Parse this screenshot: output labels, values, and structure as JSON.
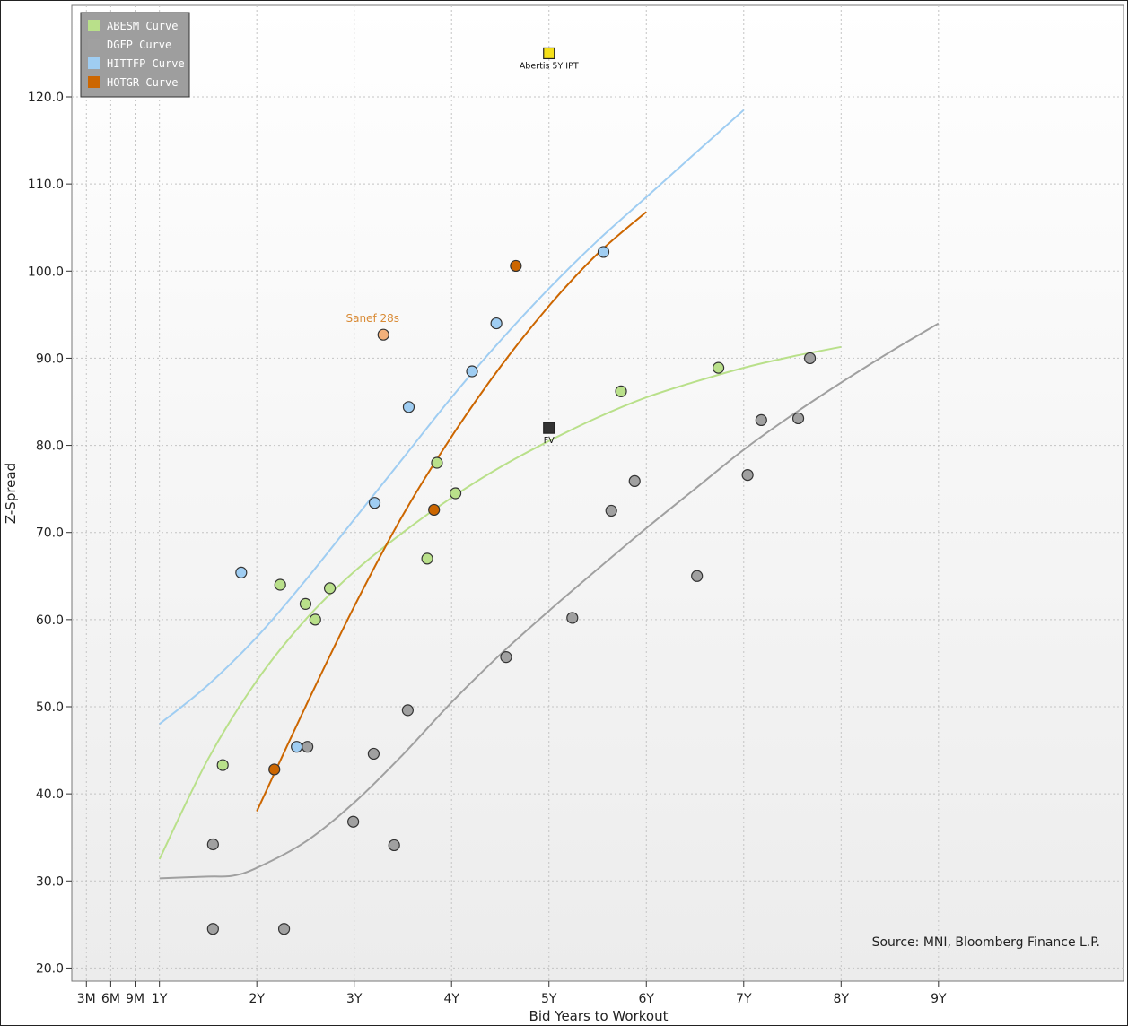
{
  "chart_data": {
    "type": "scatter",
    "title": "",
    "xlabel": "Bid Years to Workout",
    "ylabel": "Z-Spread",
    "xlim": [
      -0.9,
      9.9
    ],
    "ylim": [
      18.5,
      130.5
    ],
    "x_ticks": [
      {
        "value": -0.75,
        "label": "3M"
      },
      {
        "value": -0.5,
        "label": "6M"
      },
      {
        "value": -0.25,
        "label": "9M"
      },
      {
        "value": 0,
        "label": "1Y"
      },
      {
        "value": 1,
        "label": "2Y"
      },
      {
        "value": 2,
        "label": "3Y"
      },
      {
        "value": 3,
        "label": "4Y"
      },
      {
        "value": 4,
        "label": "5Y"
      },
      {
        "value": 5,
        "label": "6Y"
      },
      {
        "value": 6,
        "label": "7Y"
      },
      {
        "value": 7,
        "label": "8Y"
      },
      {
        "value": 8,
        "label": "9Y"
      }
    ],
    "y_ticks": [
      {
        "value": 20,
        "label": "20.0"
      },
      {
        "value": 30,
        "label": "30.0"
      },
      {
        "value": 40,
        "label": "40.0"
      },
      {
        "value": 50,
        "label": "50.0"
      },
      {
        "value": 60,
        "label": "60.0"
      },
      {
        "value": 70,
        "label": "70.0"
      },
      {
        "value": 80,
        "label": "80.0"
      },
      {
        "value": 90,
        "label": "90.0"
      },
      {
        "value": 100,
        "label": "100.0"
      },
      {
        "value": 110,
        "label": "110.0"
      },
      {
        "value": 120,
        "label": "120.0"
      }
    ],
    "grid": true,
    "legend_position": "top-left",
    "series": [
      {
        "name": "ABESM Curve",
        "color": "#b9e08a",
        "curve": [
          [
            0,
            32.5
          ],
          [
            0.5,
            44
          ],
          [
            1,
            53
          ],
          [
            1.5,
            60
          ],
          [
            2,
            65.5
          ],
          [
            2.5,
            70
          ],
          [
            3,
            74
          ],
          [
            3.5,
            77.5
          ],
          [
            4,
            80.5
          ],
          [
            4.5,
            83.2
          ],
          [
            5,
            85.5
          ],
          [
            5.5,
            87.3
          ],
          [
            6,
            88.9
          ],
          [
            6.5,
            90.2
          ],
          [
            7,
            91.3
          ]
        ],
        "points": [
          [
            0.65,
            43.3
          ],
          [
            1.24,
            64
          ],
          [
            1.5,
            61.8
          ],
          [
            1.6,
            60
          ],
          [
            1.75,
            63.6
          ],
          [
            2.75,
            67
          ],
          [
            2.85,
            78
          ],
          [
            3.04,
            74.5
          ],
          [
            4.74,
            86.2
          ],
          [
            5.74,
            88.9
          ]
        ]
      },
      {
        "name": "DGFP Curve",
        "color": "#a0a0a0",
        "curve": [
          [
            0,
            30.3
          ],
          [
            0.5,
            30.5
          ],
          [
            0.75,
            30.6
          ],
          [
            1,
            31.5
          ],
          [
            1.5,
            34.5
          ],
          [
            2,
            39
          ],
          [
            2.5,
            44.5
          ],
          [
            3,
            50.5
          ],
          [
            3.5,
            56
          ],
          [
            4,
            61
          ],
          [
            4.5,
            65.8
          ],
          [
            5,
            70.5
          ],
          [
            5.5,
            75
          ],
          [
            6,
            79.5
          ],
          [
            6.5,
            83.5
          ],
          [
            7,
            87.2
          ],
          [
            7.5,
            90.7
          ],
          [
            8,
            94
          ]
        ],
        "points": [
          [
            0.55,
            34.2
          ],
          [
            0.55,
            24.5
          ],
          [
            1.28,
            24.5
          ],
          [
            1.52,
            45.4
          ],
          [
            1.99,
            36.8
          ],
          [
            2.2,
            44.6
          ],
          [
            2.41,
            34.1
          ],
          [
            2.55,
            49.6
          ],
          [
            3.56,
            55.7
          ],
          [
            4.24,
            60.2
          ],
          [
            4.64,
            72.5
          ],
          [
            4.88,
            75.9
          ],
          [
            5.52,
            65
          ],
          [
            6.04,
            76.6
          ],
          [
            6.18,
            82.9
          ],
          [
            6.56,
            83.1
          ],
          [
            6.68,
            90
          ]
        ]
      },
      {
        "name": "HITTFP Curve",
        "color": "#9fcdf2",
        "curve": [
          [
            0,
            48
          ],
          [
            0.5,
            52.5
          ],
          [
            1,
            58
          ],
          [
            1.5,
            64.5
          ],
          [
            2,
            71.5
          ],
          [
            2.5,
            78.5
          ],
          [
            3,
            85.5
          ],
          [
            3.5,
            92
          ],
          [
            4,
            98
          ],
          [
            4.5,
            103.5
          ],
          [
            5,
            108.5
          ],
          [
            5.5,
            113.5
          ],
          [
            6,
            118.5
          ]
        ],
        "points": [
          [
            0.84,
            65.4
          ],
          [
            1.41,
            45.4
          ],
          [
            2.21,
            73.4
          ],
          [
            2.56,
            84.4
          ],
          [
            3.21,
            88.5
          ],
          [
            3.46,
            94
          ],
          [
            4.56,
            102.2
          ]
        ]
      },
      {
        "name": "HOTGR Curve",
        "color": "#cc6600",
        "curve": [
          [
            1,
            38
          ],
          [
            1.5,
            50
          ],
          [
            2,
            61.5
          ],
          [
            2.5,
            72
          ],
          [
            3,
            81
          ],
          [
            3.5,
            89
          ],
          [
            4,
            96
          ],
          [
            4.5,
            102
          ],
          [
            5,
            106.8
          ]
        ],
        "points": [
          [
            1.18,
            42.8
          ],
          [
            2.82,
            72.6
          ],
          [
            3.66,
            100.6
          ]
        ]
      }
    ],
    "highlight_points": [
      {
        "label": "Sanef 28s",
        "x": 2.3,
        "y": 92.7,
        "color": "#f2b07a",
        "label_color": "#d98b36"
      }
    ],
    "markers": [
      {
        "label": "Abertis 5Y IPT",
        "x": 4,
        "y": 125,
        "color": "#f5e01a"
      },
      {
        "label": "FV",
        "x": 4,
        "y": 82,
        "color": "#333333"
      }
    ],
    "source": "Source: MNI, Bloomberg Finance L.P."
  }
}
